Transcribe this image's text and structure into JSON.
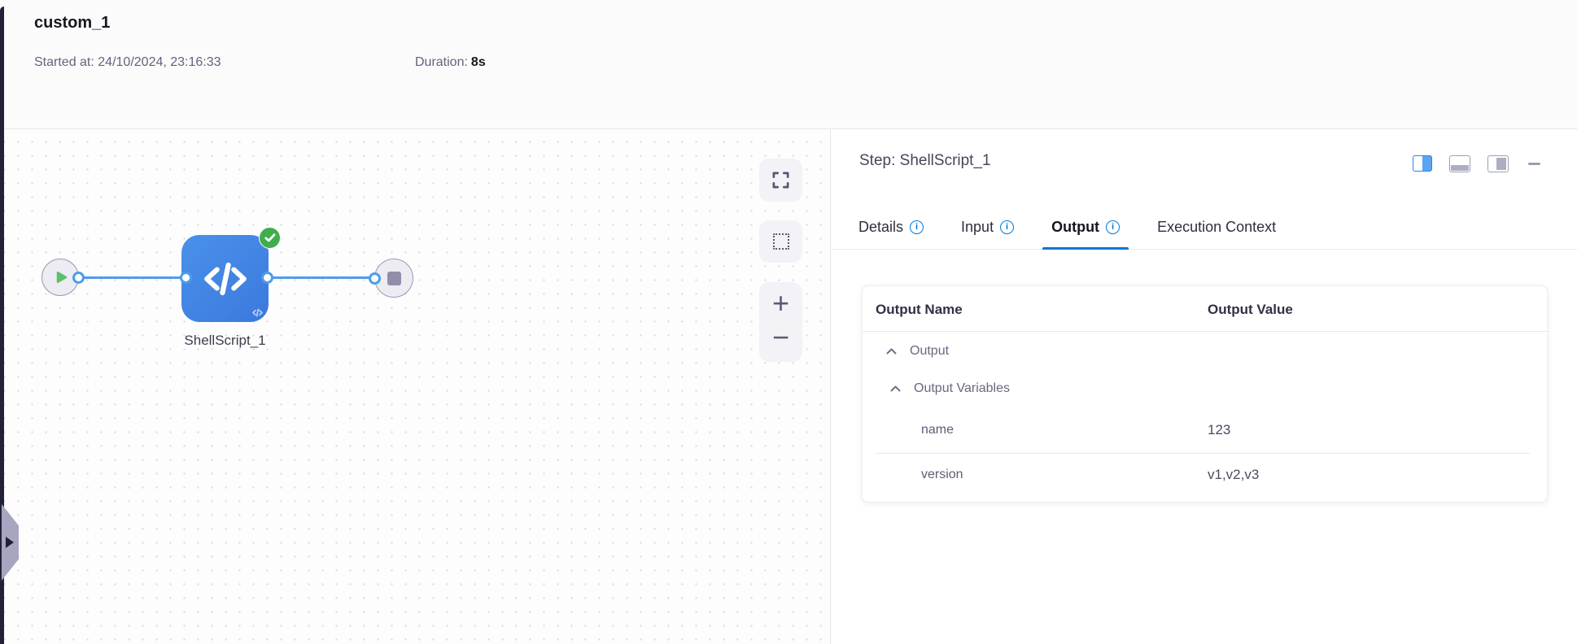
{
  "header": {
    "title": "custom_1",
    "started_label": "Started at:",
    "started_value": "24/10/2024, 23:16:33",
    "duration_label": "Duration:",
    "duration_value": "8s"
  },
  "canvas": {
    "node_label": "ShellScript_1",
    "node_status": "success"
  },
  "icons": {
    "zoom_in": "+",
    "zoom_out": "−",
    "info": "i",
    "fullscreen": "corner-brackets",
    "marquee_select": "dashed-square",
    "node_type": "code-brackets",
    "success_check": "check",
    "start_node": "play-triangle",
    "stop_node": "stop-square",
    "collapse_handle": "right-arrow",
    "expand_state": "chevron-up"
  },
  "panel": {
    "title": "Step: ShellScript_1",
    "tabs": [
      {
        "label": "Details",
        "info": true,
        "active": false
      },
      {
        "label": "Input",
        "info": true,
        "active": false
      },
      {
        "label": "Output",
        "info": true,
        "active": true
      },
      {
        "label": "Execution Context",
        "info": false,
        "active": false
      }
    ],
    "table": {
      "columns": [
        "Output Name",
        "Output Value"
      ],
      "rows": [
        {
          "type": "group",
          "label": "Output",
          "level": 0,
          "expanded": true
        },
        {
          "type": "group",
          "label": "Output Variables",
          "level": 1,
          "expanded": true
        },
        {
          "type": "leaf",
          "name": "name",
          "value": "123"
        },
        {
          "type": "leaf",
          "name": "version",
          "value": "v1,v2,v3"
        }
      ]
    }
  },
  "colors": {
    "accent_blue": "#0278d5",
    "node_blue": "#3e7fdd",
    "connector_blue": "#4f9ce8",
    "success_green": "#41ad4c",
    "play_green": "#5fbe6c",
    "dark_strip": "#212139",
    "header_bg": "#fbfbfc",
    "muted_text": "#676980"
  }
}
